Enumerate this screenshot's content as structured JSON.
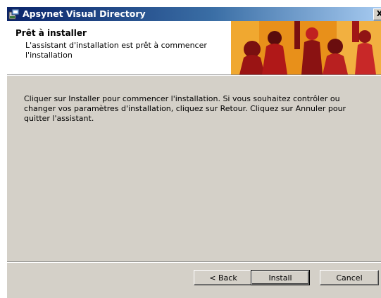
{
  "window": {
    "title": "Apsynet Visual Directory",
    "close_label": "X"
  },
  "banner": {
    "title": "Prêt à installer",
    "subtitle": "L'assistant d'installation est prêt à commencer l'installation"
  },
  "body": {
    "text": "Cliquer sur Installer pour commencer l'installation. Si vous souhaitez contrôler ou changer vos paramètres d'installation, cliquez sur Retour. Cliquez sur Annuler pour quitter l'assistant."
  },
  "buttons": {
    "back": "< Back",
    "install": "Install",
    "cancel": "Cancel"
  },
  "colors": {
    "titlebar_start": "#0a246a",
    "titlebar_end": "#a6caf0",
    "dialog_face": "#d4d0c8",
    "banner_orange": "#e8901a",
    "banner_red": "#b01818"
  }
}
